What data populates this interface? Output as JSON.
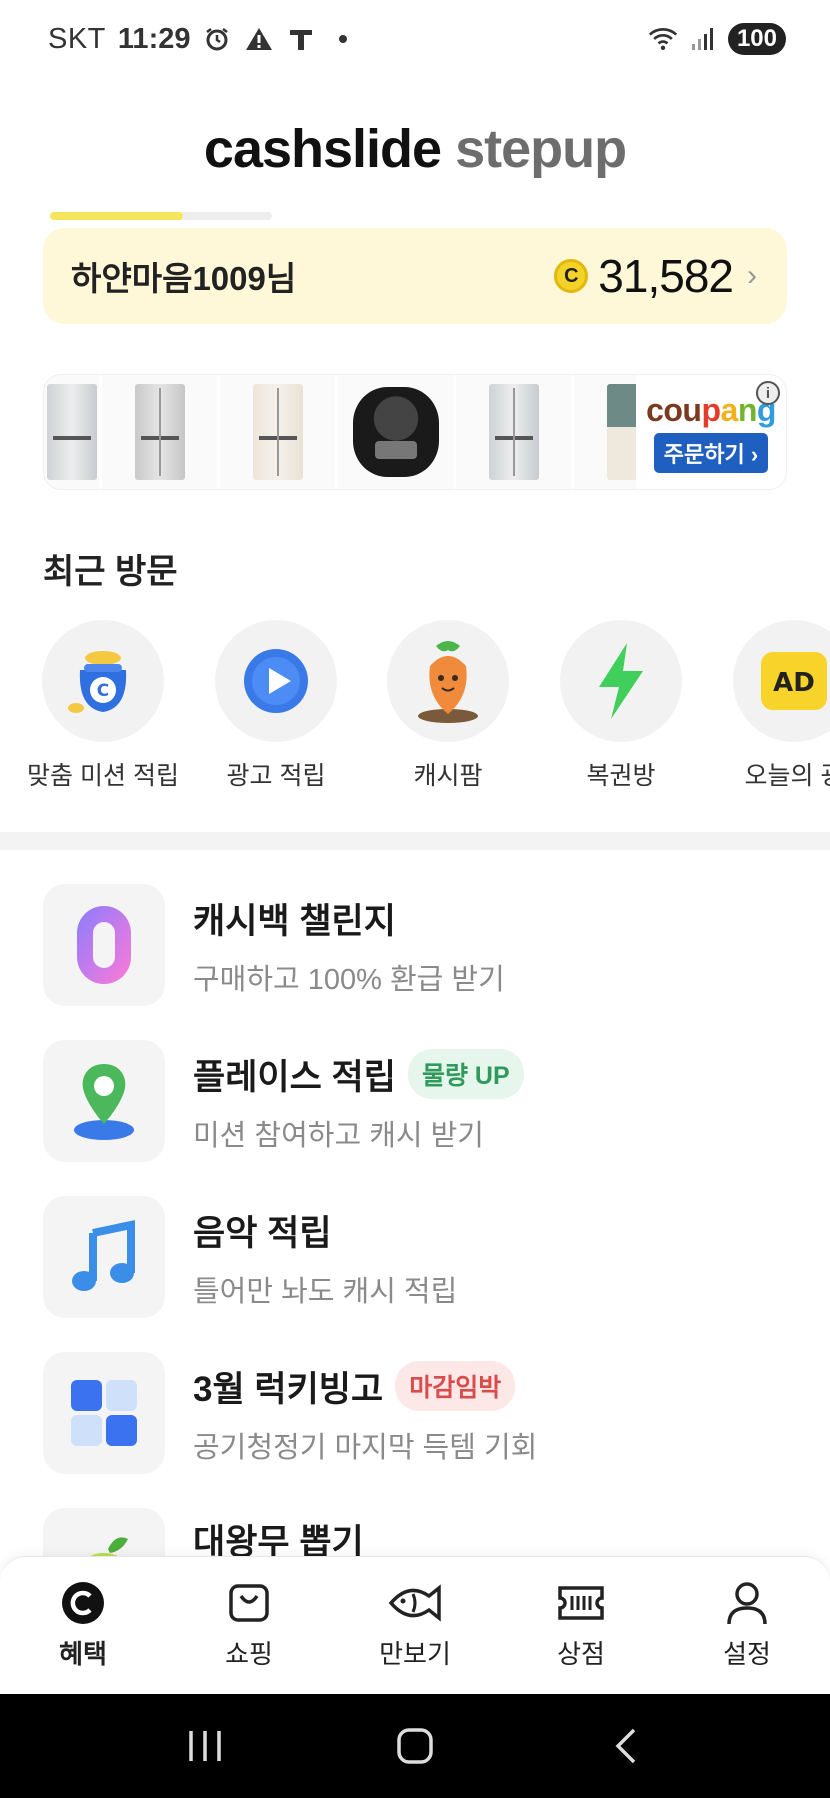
{
  "status_bar": {
    "carrier": "SKT",
    "time": "11:29",
    "battery": "100",
    "icons": [
      "alarm-icon",
      "warning-icon",
      "t-icon",
      "dot-icon",
      "wifi-icon",
      "signal-icon"
    ]
  },
  "header": {
    "brand": "cashslide",
    "sub_brand": "stepup",
    "progress_fraction": 0.6
  },
  "user": {
    "name": "하얀마음1009님",
    "coin_symbol": "C",
    "points": "31,582",
    "chevron": "›"
  },
  "ad": {
    "brand_parts": [
      "cou",
      "p",
      "a",
      "n",
      "g"
    ],
    "order_label": "주문하기 ›",
    "info_symbol": "i",
    "products": [
      "refrigerator",
      "refrigerator",
      "refrigerator",
      "rice-cooker",
      "refrigerator",
      "refrigerator"
    ]
  },
  "recent": {
    "title": "최근 방문",
    "items": [
      {
        "label": "맞춤 미션 적립",
        "icon": "money-bag-icon"
      },
      {
        "label": "광고 적립",
        "icon": "play-icon"
      },
      {
        "label": "캐시팜",
        "icon": "carrot-icon"
      },
      {
        "label": "복권방",
        "icon": "lightning-icon"
      },
      {
        "label": "오늘의 광",
        "icon": "ad-icon",
        "icon_text": "AD"
      }
    ]
  },
  "list": [
    {
      "title": "캐시백 챌린지",
      "subtitle": "구매하고 100% 환급 받기",
      "badge": "",
      "icon": "zero-icon"
    },
    {
      "title": "플레이스 적립",
      "subtitle": "미션 참여하고 캐시 받기",
      "badge": "물량 UP",
      "badge_color": "#2f9a5c",
      "icon": "map-pin-icon"
    },
    {
      "title": "음악 적립",
      "subtitle": "틀어만 놔도 캐시 적립",
      "badge": "",
      "icon": "music-note-icon"
    },
    {
      "title": "3월 럭키빙고",
      "subtitle": "공기청정기 마지막 득템 기회",
      "badge": "마감임박",
      "badge_color": "#d84c4c",
      "icon": "grid-icon"
    },
    {
      "title": "대왕무 뽑기",
      "subtitle": "",
      "badge": "",
      "icon": "radish-icon"
    }
  ],
  "bottom_nav": [
    {
      "label": "혜택",
      "icon": "cash-coin-icon",
      "active": true
    },
    {
      "label": "쇼핑",
      "icon": "shopping-bag-icon",
      "active": false
    },
    {
      "label": "만보기",
      "icon": "fish-icon",
      "active": false
    },
    {
      "label": "상점",
      "icon": "ticket-icon",
      "active": false
    },
    {
      "label": "설정",
      "icon": "person-icon",
      "active": false
    }
  ],
  "colors": {
    "accent_yellow": "#f6e45a",
    "card_bg": "#fff8d8",
    "coupang_blue": "#1f5fbf"
  }
}
